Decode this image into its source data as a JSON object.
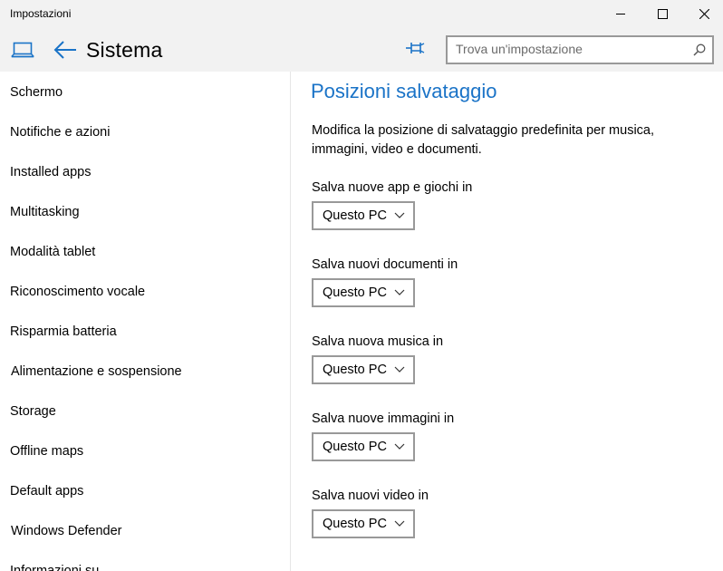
{
  "window": {
    "title": "Impostazioni",
    "controls": {
      "minimize": "minimize-icon",
      "maximize": "maximize-icon",
      "close": "close-icon"
    }
  },
  "header": {
    "app_icon": "laptop-icon",
    "back_icon": "back-arrow-icon",
    "title": "Sistema",
    "pin_icon": "pin-icon",
    "search_placeholder": "Trova un'impostazione",
    "search_value": "",
    "search_icon": "search-icon"
  },
  "sidebar": {
    "items": [
      {
        "label": "Schermo"
      },
      {
        "label": "Notifiche e azioni"
      },
      {
        "label": "Installed apps"
      },
      {
        "label": "Multitasking"
      },
      {
        "label": "Modalità tablet"
      },
      {
        "label": "Riconoscimento vocale"
      },
      {
        "label": "Risparmia batteria"
      },
      {
        "label": "Alimentazione e sospensione"
      },
      {
        "label": "Storage"
      },
      {
        "label": "Offline maps"
      },
      {
        "label": "Default apps"
      },
      {
        "label": "Windows Defender"
      },
      {
        "label": "Informazioni su"
      }
    ]
  },
  "main": {
    "heading": "Posizioni salvataggio",
    "description": "Modifica la posizione di salvataggio predefinita per musica, immagini, video e documenti.",
    "fields": [
      {
        "label": "Salva nuove app e giochi in",
        "value": "Questo PC"
      },
      {
        "label": "Salva nuovi documenti in",
        "value": "Questo PC"
      },
      {
        "label": "Salva nuova musica in",
        "value": "Questo PC"
      },
      {
        "label": "Salva nuove immagini in",
        "value": "Questo PC"
      },
      {
        "label": "Salva nuovi video in",
        "value": "Questo PC"
      }
    ]
  },
  "colors": {
    "accent": "#1a73c7",
    "titlebar_bg": "#f2f2f2",
    "border": "#999999"
  }
}
